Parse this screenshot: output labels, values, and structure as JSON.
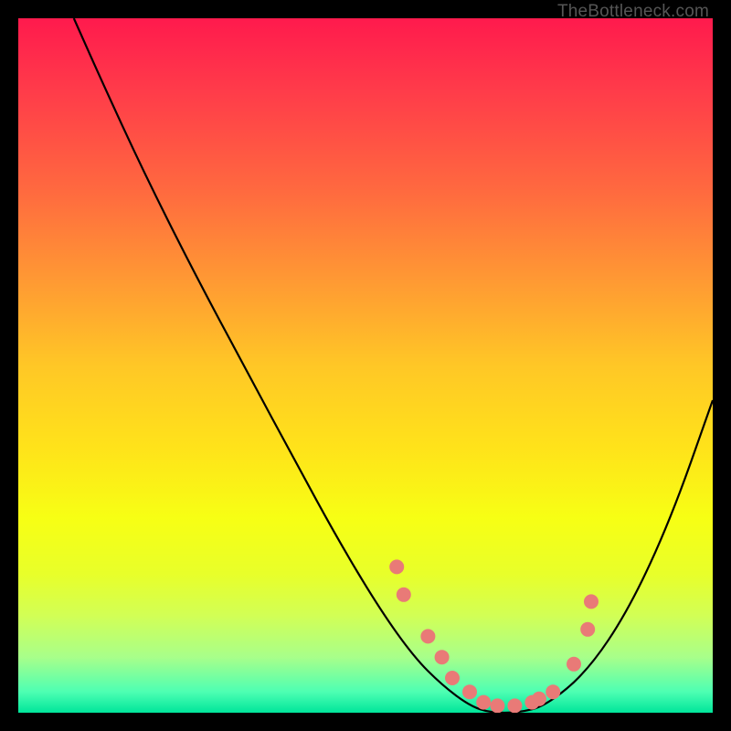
{
  "watermark": "TheBottleneck.com",
  "chart_data": {
    "type": "line",
    "title": "",
    "xlabel": "",
    "ylabel": "",
    "xlim": [
      0,
      100
    ],
    "ylim": [
      0,
      100
    ],
    "grid": false,
    "legend": null,
    "series": [
      {
        "name": "curve",
        "x": [
          8,
          12,
          18,
          25,
          33,
          40,
          46,
          52,
          57,
          61,
          65,
          68,
          72,
          76,
          82,
          88,
          94,
          100
        ],
        "y": [
          100,
          91,
          78,
          64,
          49,
          36,
          25,
          15,
          8,
          4,
          1,
          0,
          0,
          1,
          6,
          15,
          28,
          45
        ]
      }
    ],
    "markers": {
      "name": "dots",
      "x": [
        54.5,
        55.5,
        59,
        61,
        62.5,
        65,
        67,
        69,
        71.5,
        74,
        75,
        77,
        80,
        82,
        82.5
      ],
      "y": [
        21,
        17,
        11,
        8,
        5,
        3,
        1.5,
        1,
        1,
        1.5,
        2,
        3,
        7,
        12,
        16
      ]
    },
    "gradient_stops": [
      {
        "offset": 0,
        "color": "#ff1a4d"
      },
      {
        "offset": 50,
        "color": "#ffc726"
      },
      {
        "offset": 80,
        "color": "#e8ff2a"
      },
      {
        "offset": 100,
        "color": "#00e59a"
      }
    ]
  }
}
